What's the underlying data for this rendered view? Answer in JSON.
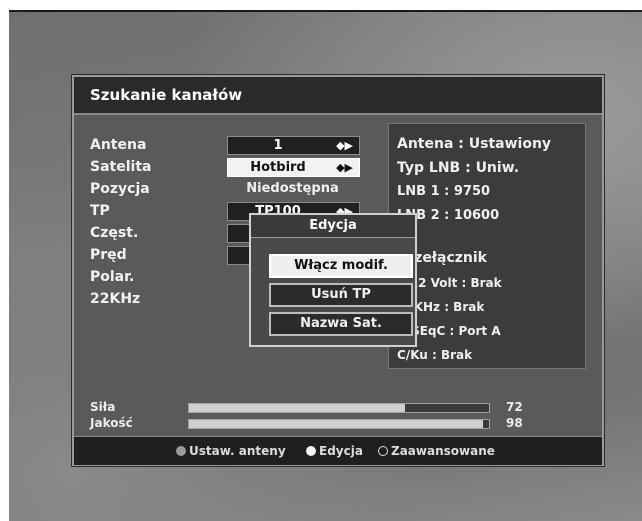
{
  "dialog": {
    "title": "Szukanie kanałów"
  },
  "form": {
    "labels": [
      "Antena",
      "Satelita",
      "Pozycja",
      "TP",
      "Częst.",
      "Pręd",
      "Polar.",
      "22KHz"
    ],
    "antena_value": "1",
    "satelita_value": "Hotbird",
    "pozycja_value": "Niedostępna",
    "tp_value": "TP100",
    "arrow_glyph": "◆▶"
  },
  "info": {
    "lines": [
      "Antena : Ustawiony",
      "Typ LNB : Uniw.",
      "LNB 1 : 9750",
      "LNB 2 : 10600",
      "Przełącznik",
      "0/12 Volt : Brak",
      "22KHz : Brak",
      "DiSEqC : Port A",
      "C/Ku : Brak"
    ]
  },
  "popup": {
    "title": "Edycja",
    "items": [
      "Włącz modif.",
      "Usuń TP",
      "Nazwa Sat."
    ],
    "selected_index": 0
  },
  "meters": {
    "sila_label": "Siła",
    "sila_value": "72",
    "sila_fraction": 0.72,
    "jakosc_label": "Jakość",
    "jakosc_value": "98",
    "jakosc_fraction": 0.98
  },
  "footer": {
    "items": [
      "Ustaw. anteny",
      "Edycja",
      "Zaawansowane"
    ],
    "dot_colors": [
      "#9a9a9a",
      "#f4f4f4",
      "#1f1f1f"
    ]
  }
}
